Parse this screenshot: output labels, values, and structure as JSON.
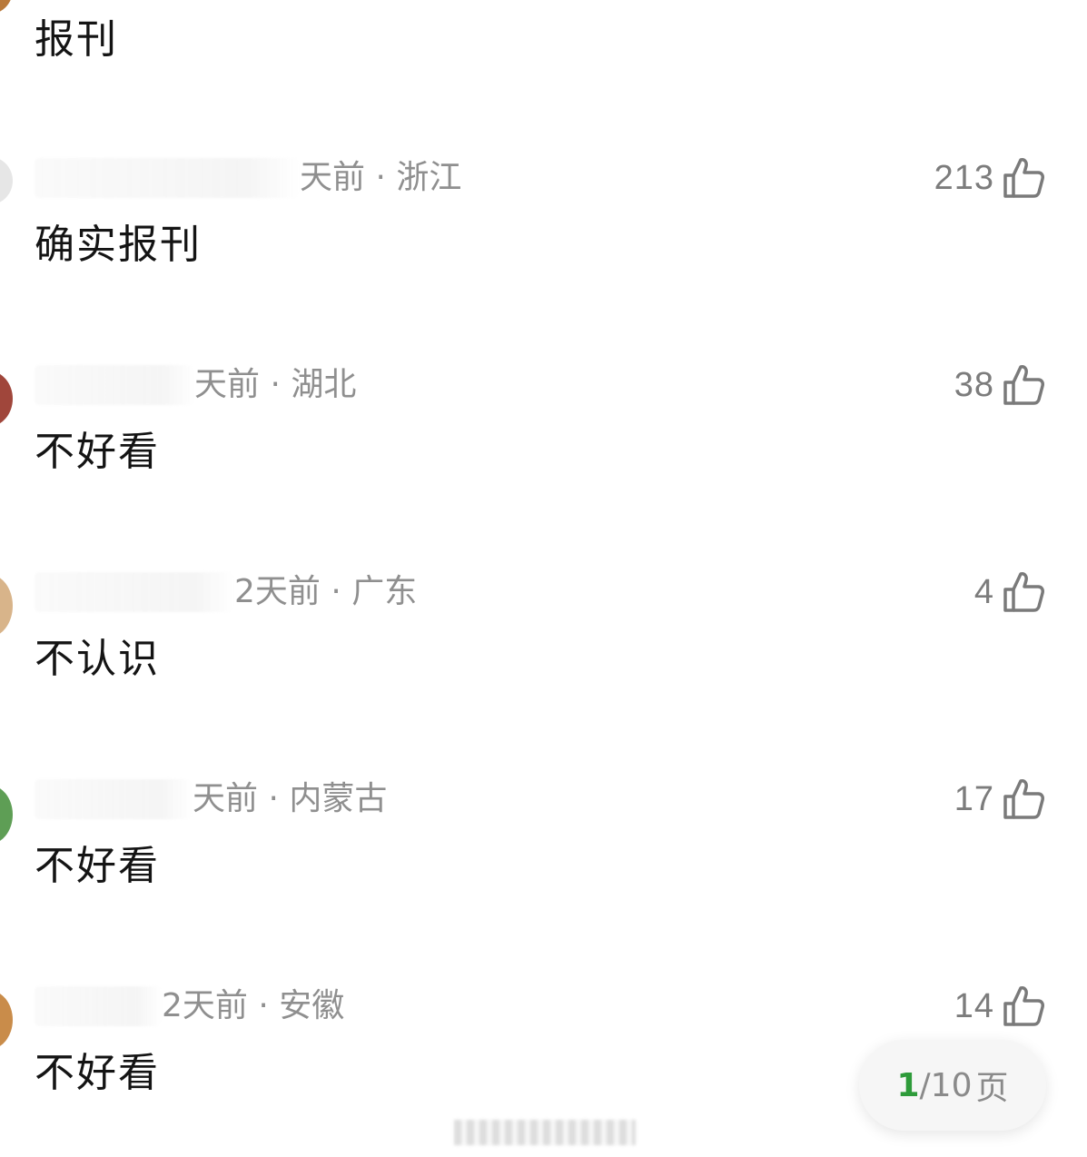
{
  "comments": [
    {
      "meta": "",
      "text": "报刊",
      "likes": "",
      "avatar_color": "#b9793a"
    },
    {
      "meta": "天前 · 浙江",
      "text": "确实报刊",
      "likes": "213",
      "avatar_color": "#e4e4e4"
    },
    {
      "meta": "天前 · 湖北",
      "text": "不好看",
      "likes": "38",
      "avatar_color": "#a0463b"
    },
    {
      "meta": "2天前 · 广东",
      "text": "不认识",
      "likes": "4",
      "avatar_color": "#d8b48a"
    },
    {
      "meta": "天前 · 内蒙古",
      "text": "不好看",
      "likes": "17",
      "avatar_color": "#5e9e55"
    },
    {
      "meta": "2天前 · 安徽",
      "text": "不好看",
      "likes": "14",
      "avatar_color": "#c98c4a"
    }
  ],
  "pager": {
    "current": "1",
    "total": "/10",
    "unit": "页"
  },
  "colors": {
    "page_indicator_accent": "#2e9b3a",
    "meta_gray": "#8f8f8f",
    "body_text": "#141414"
  },
  "icons": {
    "like": "thumbs-up-icon"
  }
}
